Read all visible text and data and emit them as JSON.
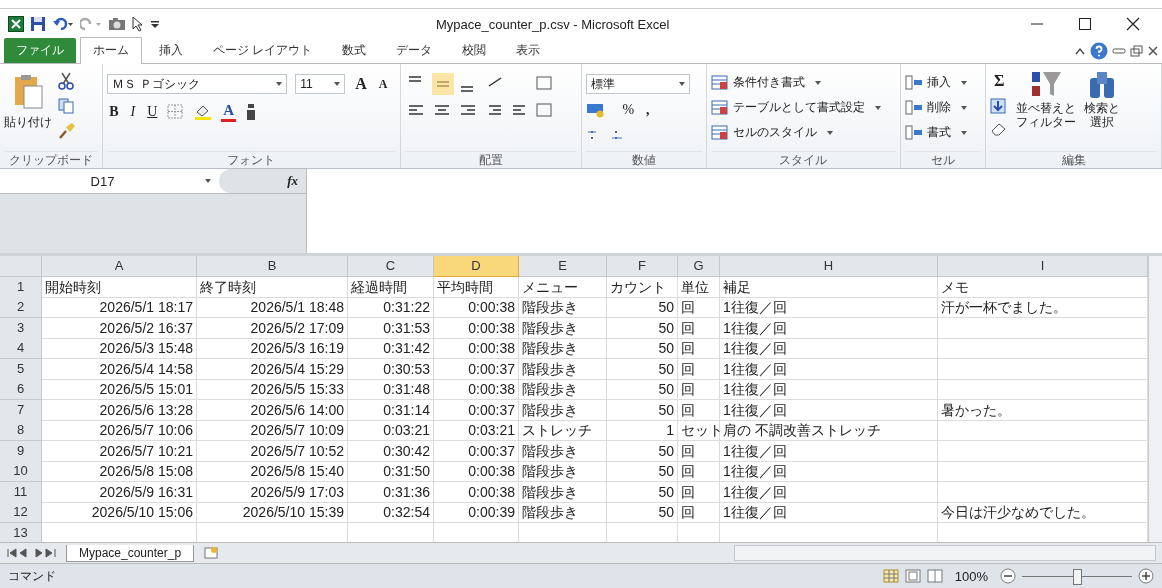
{
  "window": {
    "title": "Mypace_counter_p.csv - Microsoft Excel"
  },
  "tabs": [
    {
      "label": "ファイル",
      "kind": "file",
      "selected": false
    },
    {
      "label": "ホーム",
      "kind": "tab",
      "selected": true
    },
    {
      "label": "挿入",
      "kind": "tab",
      "selected": false
    },
    {
      "label": "ページ レイアウト",
      "kind": "tab",
      "selected": false
    },
    {
      "label": "数式",
      "kind": "tab",
      "selected": false
    },
    {
      "label": "データ",
      "kind": "tab",
      "selected": false
    },
    {
      "label": "校閲",
      "kind": "tab",
      "selected": false
    },
    {
      "label": "表示",
      "kind": "tab",
      "selected": false
    }
  ],
  "ribbon": {
    "clipboard": {
      "label": "クリップボード",
      "paste": "貼り付け"
    },
    "font": {
      "label": "フォント",
      "font_name": "ＭＳ Ｐゴシック",
      "font_size": "11",
      "bold": "B",
      "italic": "I",
      "underline": "U",
      "grow": "A",
      "shrink": "A",
      "font_color_button": "A"
    },
    "alignment": {
      "label": "配置"
    },
    "number": {
      "label": "数値",
      "format": "標準",
      "percent": "%",
      "comma": ","
    },
    "styles": {
      "label": "スタイル",
      "items": [
        "条件付き書式",
        "テーブルとして書式設定",
        "セルのスタイル"
      ]
    },
    "cells": {
      "label": "セル",
      "items": [
        "挿入",
        "削除",
        "書式"
      ]
    },
    "editing": {
      "label": "編集",
      "sum": "Σ",
      "sort": [
        "並べ替えと",
        "フィルター"
      ],
      "find": [
        "検索と",
        "選択"
      ]
    }
  },
  "formula_bar": {
    "name_box": "D17",
    "fx": "fx"
  },
  "columns": [
    {
      "letter": "A",
      "selected": false
    },
    {
      "letter": "B",
      "selected": false
    },
    {
      "letter": "C",
      "selected": false
    },
    {
      "letter": "D",
      "selected": true
    },
    {
      "letter": "E",
      "selected": false
    },
    {
      "letter": "F",
      "selected": false
    },
    {
      "letter": "G",
      "selected": false
    },
    {
      "letter": "H",
      "selected": false
    },
    {
      "letter": "I",
      "selected": false
    }
  ],
  "rows": [
    {
      "num": "1",
      "cells": [
        "開始時刻",
        "終了時刻",
        "経過時間",
        "平均時間",
        "メニュー",
        "カウント",
        "単位",
        "補足",
        "メモ"
      ]
    },
    {
      "num": "2",
      "cells": [
        "2026/5/1 18:17",
        "2026/5/1 18:48",
        "0:31:22",
        "0:00:38",
        "階段歩き",
        "50",
        "回",
        "1往復／回",
        "汗が一杯でました。"
      ]
    },
    {
      "num": "3",
      "cells": [
        "2026/5/2 16:37",
        "2026/5/2 17:09",
        "0:31:53",
        "0:00:38",
        "階段歩き",
        "50",
        "回",
        "1往復／回"
      ]
    },
    {
      "num": "4",
      "cells": [
        "2026/5/3 15:48",
        "2026/5/3 16:19",
        "0:31:42",
        "0:00:38",
        "階段歩き",
        "50",
        "回",
        "1往復／回"
      ]
    },
    {
      "num": "5",
      "cells": [
        "2026/5/4 14:58",
        "2026/5/4 15:29",
        "0:30:53",
        "0:00:37",
        "階段歩き",
        "50",
        "回",
        "1往復／回"
      ]
    },
    {
      "num": "6",
      "cells": [
        "2026/5/5 15:01",
        "2026/5/5 15:33",
        "0:31:48",
        "0:00:38",
        "階段歩き",
        "50",
        "回",
        "1往復／回"
      ]
    },
    {
      "num": "7",
      "cells": [
        "2026/5/6 13:28",
        "2026/5/6 14:00",
        "0:31:14",
        "0:00:37",
        "階段歩き",
        "50",
        "回",
        "1往復／回",
        "暑かった。"
      ]
    },
    {
      "num": "8",
      "cells": [
        "2026/5/7 10:06",
        "2026/5/7 10:09",
        "0:03:21",
        "0:03:21",
        "ストレッチ",
        "1",
        "セット",
        "肩の 不調改善ストレッチ"
      ]
    },
    {
      "num": "9",
      "cells": [
        "2026/5/7 10:21",
        "2026/5/7 10:52",
        "0:30:42",
        "0:00:37",
        "階段歩き",
        "50",
        "回",
        "1往復／回"
      ]
    },
    {
      "num": "10",
      "cells": [
        "2026/5/8 15:08",
        "2026/5/8 15:40",
        "0:31:50",
        "0:00:38",
        "階段歩き",
        "50",
        "回",
        "1往復／回"
      ]
    },
    {
      "num": "11",
      "cells": [
        "2026/5/9 16:31",
        "2026/5/9 17:03",
        "0:31:36",
        "0:00:38",
        "階段歩き",
        "50",
        "回",
        "1往復／回"
      ]
    },
    {
      "num": "12",
      "cells": [
        "2026/5/10 15:06",
        "2026/5/10 15:39",
        "0:32:54",
        "0:00:39",
        "階段歩き",
        "50",
        "回",
        "1往復／回",
        "今日は汗少なめでした。"
      ]
    },
    {
      "num": "13"
    }
  ],
  "sheet_tabs": [
    {
      "label": "Mypace_counter_p",
      "selected": true
    }
  ],
  "status_bar": {
    "mode": "コマンド",
    "zoom": "100%",
    "zoom_slider": {
      "level": 0.5
    }
  }
}
